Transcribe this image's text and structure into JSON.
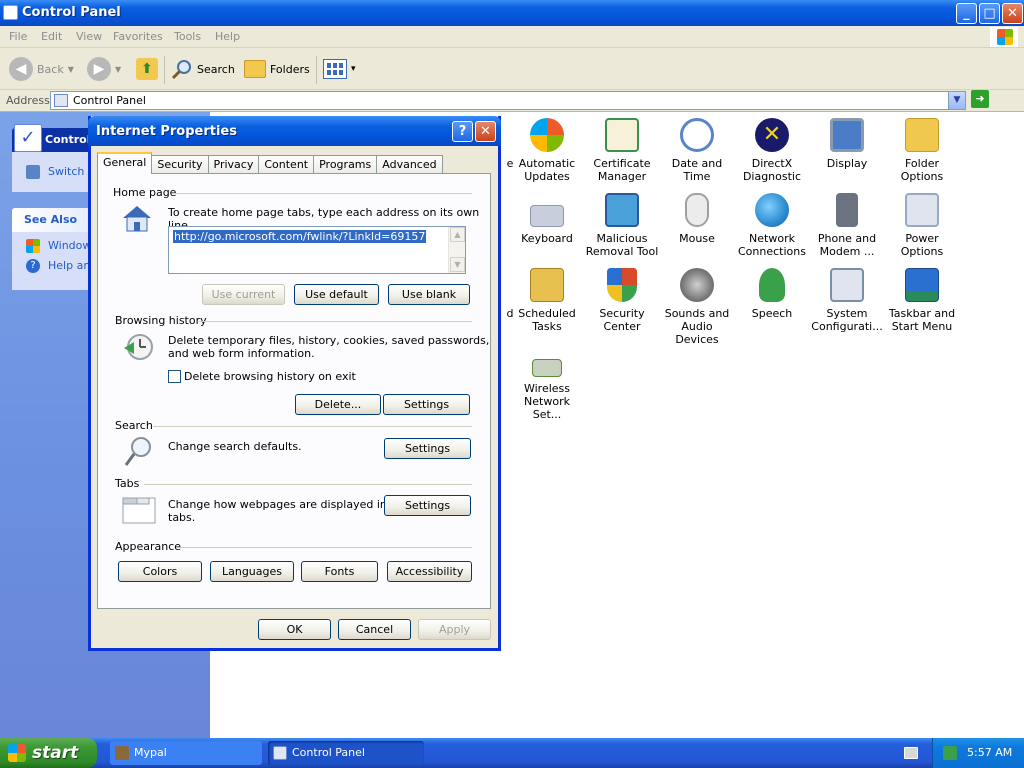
{
  "window": {
    "title": "Control Panel",
    "controls": {
      "minimize": "_",
      "maximize": "□",
      "close": "✕"
    }
  },
  "menu": [
    "File",
    "Edit",
    "View",
    "Favorites",
    "Tools",
    "Help"
  ],
  "toolbar": {
    "back": "Back",
    "search": "Search",
    "folders": "Folders",
    "back_glyph": "◀",
    "forward_glyph": "▶",
    "up_glyph": "⬆",
    "views_glyph": "▾"
  },
  "address": {
    "label": "Address",
    "value": "Control Panel",
    "drop_glyph": "▼",
    "go": "Go",
    "go_glyph": "➜"
  },
  "taskpane": {
    "control_title": "Control",
    "switch_item": "Switch t",
    "see_also": "See Also",
    "items": [
      "Window",
      "Help and"
    ]
  },
  "control_panel_items": [
    {
      "label_lines": [
        "e",
        ""
      ],
      "color": "#f2a43a"
    },
    {
      "label_lines": [
        "Automatic",
        "Updates"
      ],
      "color": "#2f74d6"
    },
    {
      "label_lines": [
        "Certificate",
        "Manager"
      ],
      "color": "#3c8f4e"
    },
    {
      "label_lines": [
        "Date and Time",
        ""
      ],
      "color": "#5a84c8"
    },
    {
      "label_lines": [
        "DirectX",
        "Diagnostic"
      ],
      "color": "#d6c21a"
    },
    {
      "label_lines": [
        "Display",
        ""
      ],
      "color": "#4a7cc8"
    },
    {
      "label_lines": [
        "Folder Options",
        ""
      ],
      "color": "#f1c84e"
    },
    {
      "label_lines": [
        "Keyboard",
        ""
      ],
      "color": "#8e9ab0"
    },
    {
      "label_lines": [
        "Malicious",
        "Removal Tool"
      ],
      "color": "#4aa0d8"
    },
    {
      "label_lines": [
        "Mouse",
        ""
      ],
      "color": "#c8c8c8"
    },
    {
      "label_lines": [
        "Network",
        "Connections"
      ],
      "color": "#2e8ad0"
    },
    {
      "label_lines": [
        "Phone and",
        "Modem ..."
      ],
      "color": "#6b7380"
    },
    {
      "label_lines": [
        "Power Options",
        ""
      ],
      "color": "#9aa8c8"
    },
    {
      "label_lines": [
        "d",
        ""
      ],
      "color": "#ffffff"
    },
    {
      "label_lines": [
        "Scheduled",
        "Tasks"
      ],
      "color": "#e8c050"
    },
    {
      "label_lines": [
        "Security",
        "Center"
      ],
      "color": "#d84a2a"
    },
    {
      "label_lines": [
        "Sounds and",
        "Audio Devices"
      ],
      "color": "#7a7a7a"
    },
    {
      "label_lines": [
        "Speech",
        ""
      ],
      "color": "#3aa04a"
    },
    {
      "label_lines": [
        "System",
        "Configurati..."
      ],
      "color": "#7890a8"
    },
    {
      "label_lines": [
        "Taskbar and",
        "Start Menu"
      ],
      "color": "#2a8a5a"
    },
    {
      "label_lines": [
        "Wireless",
        "Network Set..."
      ],
      "color": "#5a8a3a"
    }
  ],
  "dialog": {
    "title": "Internet Properties",
    "help_glyph": "?",
    "close_glyph": "✕",
    "tabs": [
      "General",
      "Security",
      "Privacy",
      "Content",
      "Programs",
      "Advanced"
    ],
    "home_page": {
      "label": "Home page",
      "desc": "To create home page tabs, type each address on its own line.",
      "url": "http://go.microsoft.com/fwlink/?LinkId=69157",
      "use_current": "Use current",
      "use_default": "Use default",
      "use_blank": "Use blank"
    },
    "browsing_history": {
      "label": "Browsing history",
      "desc_line1": "Delete temporary files, history, cookies, saved passwords,",
      "desc_line2": "and web form information.",
      "checkbox": "Delete browsing history on exit",
      "delete": "Delete...",
      "settings": "Settings"
    },
    "search": {
      "label": "Search",
      "desc": "Change search defaults.",
      "settings": "Settings"
    },
    "tabs_group": {
      "label": "Tabs",
      "desc_line1": "Change how webpages are displayed in",
      "desc_line2": "tabs.",
      "settings": "Settings"
    },
    "appearance": {
      "label": "Appearance",
      "colors": "Colors",
      "languages": "Languages",
      "fonts": "Fonts",
      "accessibility": "Accessibility"
    },
    "ok": "OK",
    "cancel": "Cancel",
    "apply": "Apply"
  },
  "taskbar": {
    "start": "start",
    "tasks": [
      "Mypal",
      "Control Panel"
    ],
    "clock": "5:57 AM"
  }
}
